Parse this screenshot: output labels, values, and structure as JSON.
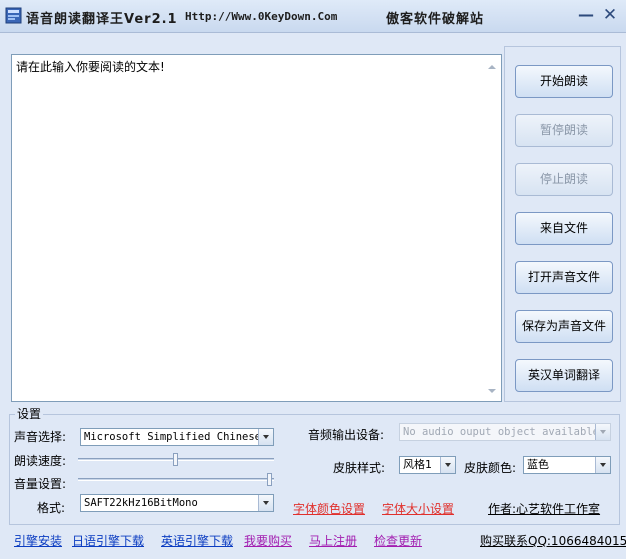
{
  "window": {
    "title": "语音朗读翻译王Ver2.1",
    "url": "Http://Www.0KeyDown.Com",
    "crack": "傲客软件破解站",
    "min_label": "—",
    "close_label": "✕"
  },
  "editor": {
    "text": "请在此输入你要阅读的文本!"
  },
  "buttons": {
    "start": "开始朗读",
    "pause": "暂停朗读",
    "stop": "停止朗读",
    "from_file": "来自文件",
    "open_audio": "打开声音文件",
    "save_audio": "保存为声音文件",
    "translate": "英汉单词翻译"
  },
  "settings": {
    "legend": "设置",
    "voice_label": "声音选择:",
    "voice_value": "Microsoft Simplified Chinese",
    "speed_label": "朗读速度:",
    "speed_level": 0.5,
    "volume_label": "音量设置:",
    "volume_level": 1.0,
    "format_label": "格式:",
    "format_value": "SAFT22kHz16BitMono",
    "audio_device_label": "音频输出设备:",
    "audio_device_value": "No audio ouput object available",
    "skin_style_label": "皮肤样式:",
    "skin_style_value": "风格1",
    "skin_color_label": "皮肤颜色:",
    "skin_color_value": "蓝色",
    "font_color_link": "字体颜色设置",
    "font_size_link": "字体大小设置",
    "author": "作者:心艺软件工作室"
  },
  "bottom_links": {
    "engine_install": "引擎安装",
    "japanese_engine": "日语引擎下载",
    "english_engine": "英语引擎下载",
    "buy": "我要购买",
    "register": "马上注册",
    "check_update": "检查更新",
    "contact": "购买联系QQ:1066484015"
  },
  "colors": {
    "accent": "#2d4a7c",
    "link_red": "#e0302c",
    "link_blue": "#0b3cc1",
    "link_purple": "#a21db0"
  }
}
